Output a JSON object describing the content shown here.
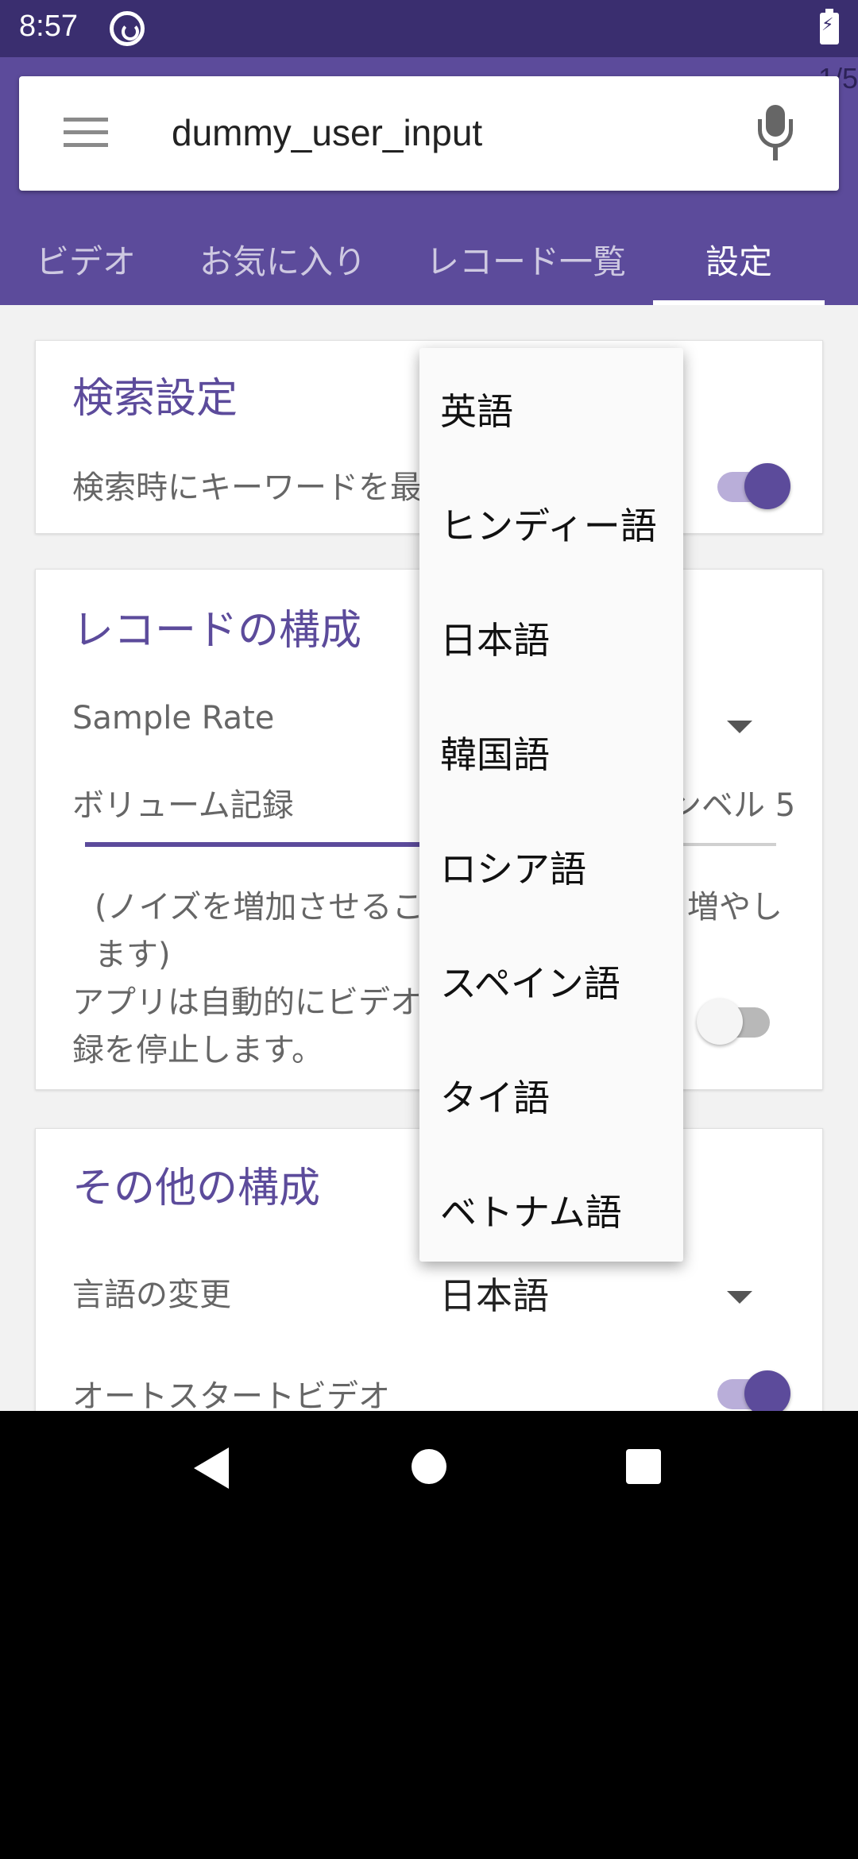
{
  "status_bar": {
    "time": "8:57",
    "sync_icon": "sync-icon",
    "battery_icon": "battery-charging-icon"
  },
  "app_bar": {
    "page_counter": "1/5",
    "search": {
      "menu_icon": "hamburger-menu-icon",
      "value": "dummy_user_input",
      "mic_icon": "microphone-icon"
    },
    "tabs": [
      {
        "label": "ビデオ",
        "active": false
      },
      {
        "label": "お気に入り",
        "active": false
      },
      {
        "label": "レコード一覧",
        "active": false
      },
      {
        "label": "設定",
        "active": true
      }
    ]
  },
  "search_settings": {
    "title": "検索設定",
    "keyword_label": "検索時にキーワードを最",
    "keyword_toggle": true
  },
  "record_settings": {
    "title": "レコードの構成",
    "sample_rate_label": "Sample Rate",
    "volume_label": "ボリューム記録",
    "volume_value": "ンベル 5",
    "volume_level": 0.5,
    "volume_hint_line1": "(ノイズを増加させるこ",
    "volume_hint_right": "増やし",
    "volume_hint_line2": "ます)",
    "auto_stop_line1": "アプリは自動的にビデオ",
    "auto_stop_line2": "録を停止します。",
    "auto_stop_toggle": false
  },
  "other_settings": {
    "title": "その他の構成",
    "language_label": "言語の変更",
    "language_value": "日本語",
    "autostart_label": "オートスタートビデオ",
    "autostart_toggle": true
  },
  "language_menu": {
    "options": [
      "英語",
      "ヒンディー語",
      "日本語",
      "韓国語",
      "ロシア語",
      "スペイン語",
      "タイ語",
      "ベトナム語"
    ]
  },
  "nav_bar": {
    "back_icon": "back-icon",
    "home_icon": "home-icon",
    "recents_icon": "recents-icon"
  },
  "colors": {
    "primary": "#5c4b9b",
    "primary_dark": "#3a2e6f",
    "toggle_track_on": "#b9aed9",
    "content_bg": "#f2f2f2"
  }
}
